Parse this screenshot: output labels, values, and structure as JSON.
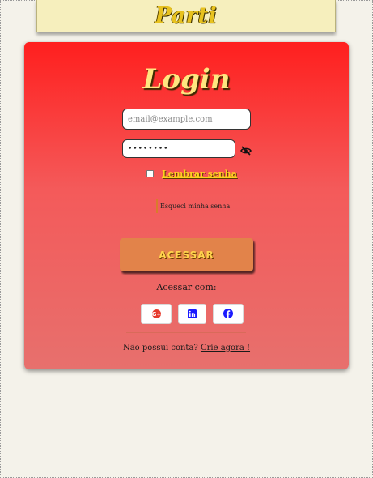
{
  "header": {
    "logo": "Parti"
  },
  "login": {
    "title": "Login",
    "email": {
      "placeholder": "email@example.com",
      "value": ""
    },
    "password": {
      "value": "••••••••"
    },
    "remember_label": "Lembrar senha",
    "forgot_label": "Esqueci minha senha",
    "submit_label": "ACESSAR",
    "social_title": "Acessar com:",
    "social": [
      {
        "icon": "google-icon",
        "color": "#e63b2e"
      },
      {
        "icon": "linkedin-icon",
        "color": "#1a1aff"
      },
      {
        "icon": "facebook-icon",
        "color": "#1a1aff"
      }
    ],
    "signup_text": "Não possui conta?",
    "signup_link": "Crie agora !"
  }
}
